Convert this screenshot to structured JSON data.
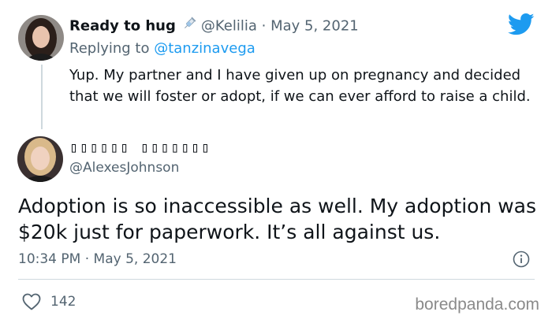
{
  "reply": {
    "avatar_icon": "profile-photo-dark-hair",
    "display_name": "Ready to hug",
    "emoji_icon": "syringe-icon",
    "handle": "@Kelilia",
    "separator": "·",
    "date": "May 5, 2021",
    "replying_prefix": "Replying to ",
    "replying_to": "@tanzinavega",
    "text": "Yup. My partner and I have given up on pregnancy and decided that we will foster or adopt, if we can ever afford to raise a child."
  },
  "main": {
    "avatar_icon": "profile-photo-blonde",
    "display_name": "▯▯▯▯▯▯ ▯▯▯▯▯▯▯",
    "handle": "@AlexesJohnson",
    "text": "Adoption is so inaccessible as well. My adoption was $20k just for paperwork. It’s all against us.",
    "time": "10:34 PM",
    "separator": "·",
    "date": "May 5, 2021",
    "likes": "142"
  },
  "brand": {
    "logo_icon": "twitter-bird-icon",
    "accent_color": "#1d9bf0",
    "watermark": "boredpanda.com"
  }
}
